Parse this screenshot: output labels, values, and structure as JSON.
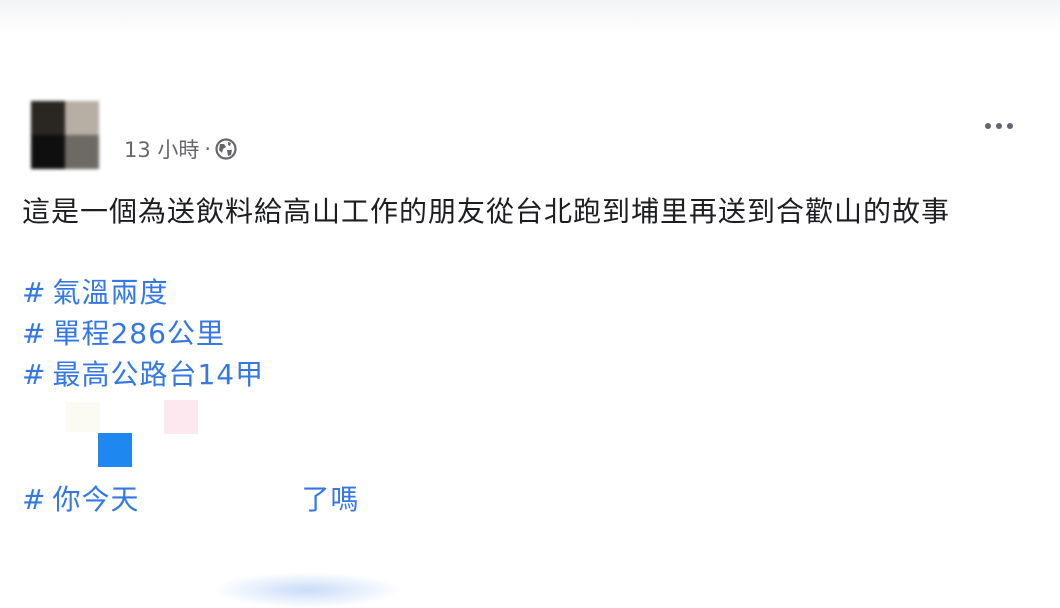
{
  "post": {
    "timestamp": "13 小時",
    "separator": "·",
    "privacy_icon": "globe-icon",
    "more_icon": "more-options-icon",
    "body": "這是一個為送飲料給高山工作的朋友從台北跑到埔里再送到合歡山的故事",
    "hashtags": [
      {
        "hash": "#",
        "text": "氣溫兩度"
      },
      {
        "hash": "#",
        "text": "單程286公里"
      },
      {
        "hash": "#",
        "text": "最高公路台14甲"
      },
      {
        "hash": "#",
        "text_start": "你今天",
        "text_end": "了嗎"
      }
    ]
  },
  "colors": {
    "link": "#3578e5",
    "text": "#1c1e21",
    "meta": "#65676b",
    "emoji_blue": "#1e88f0"
  }
}
